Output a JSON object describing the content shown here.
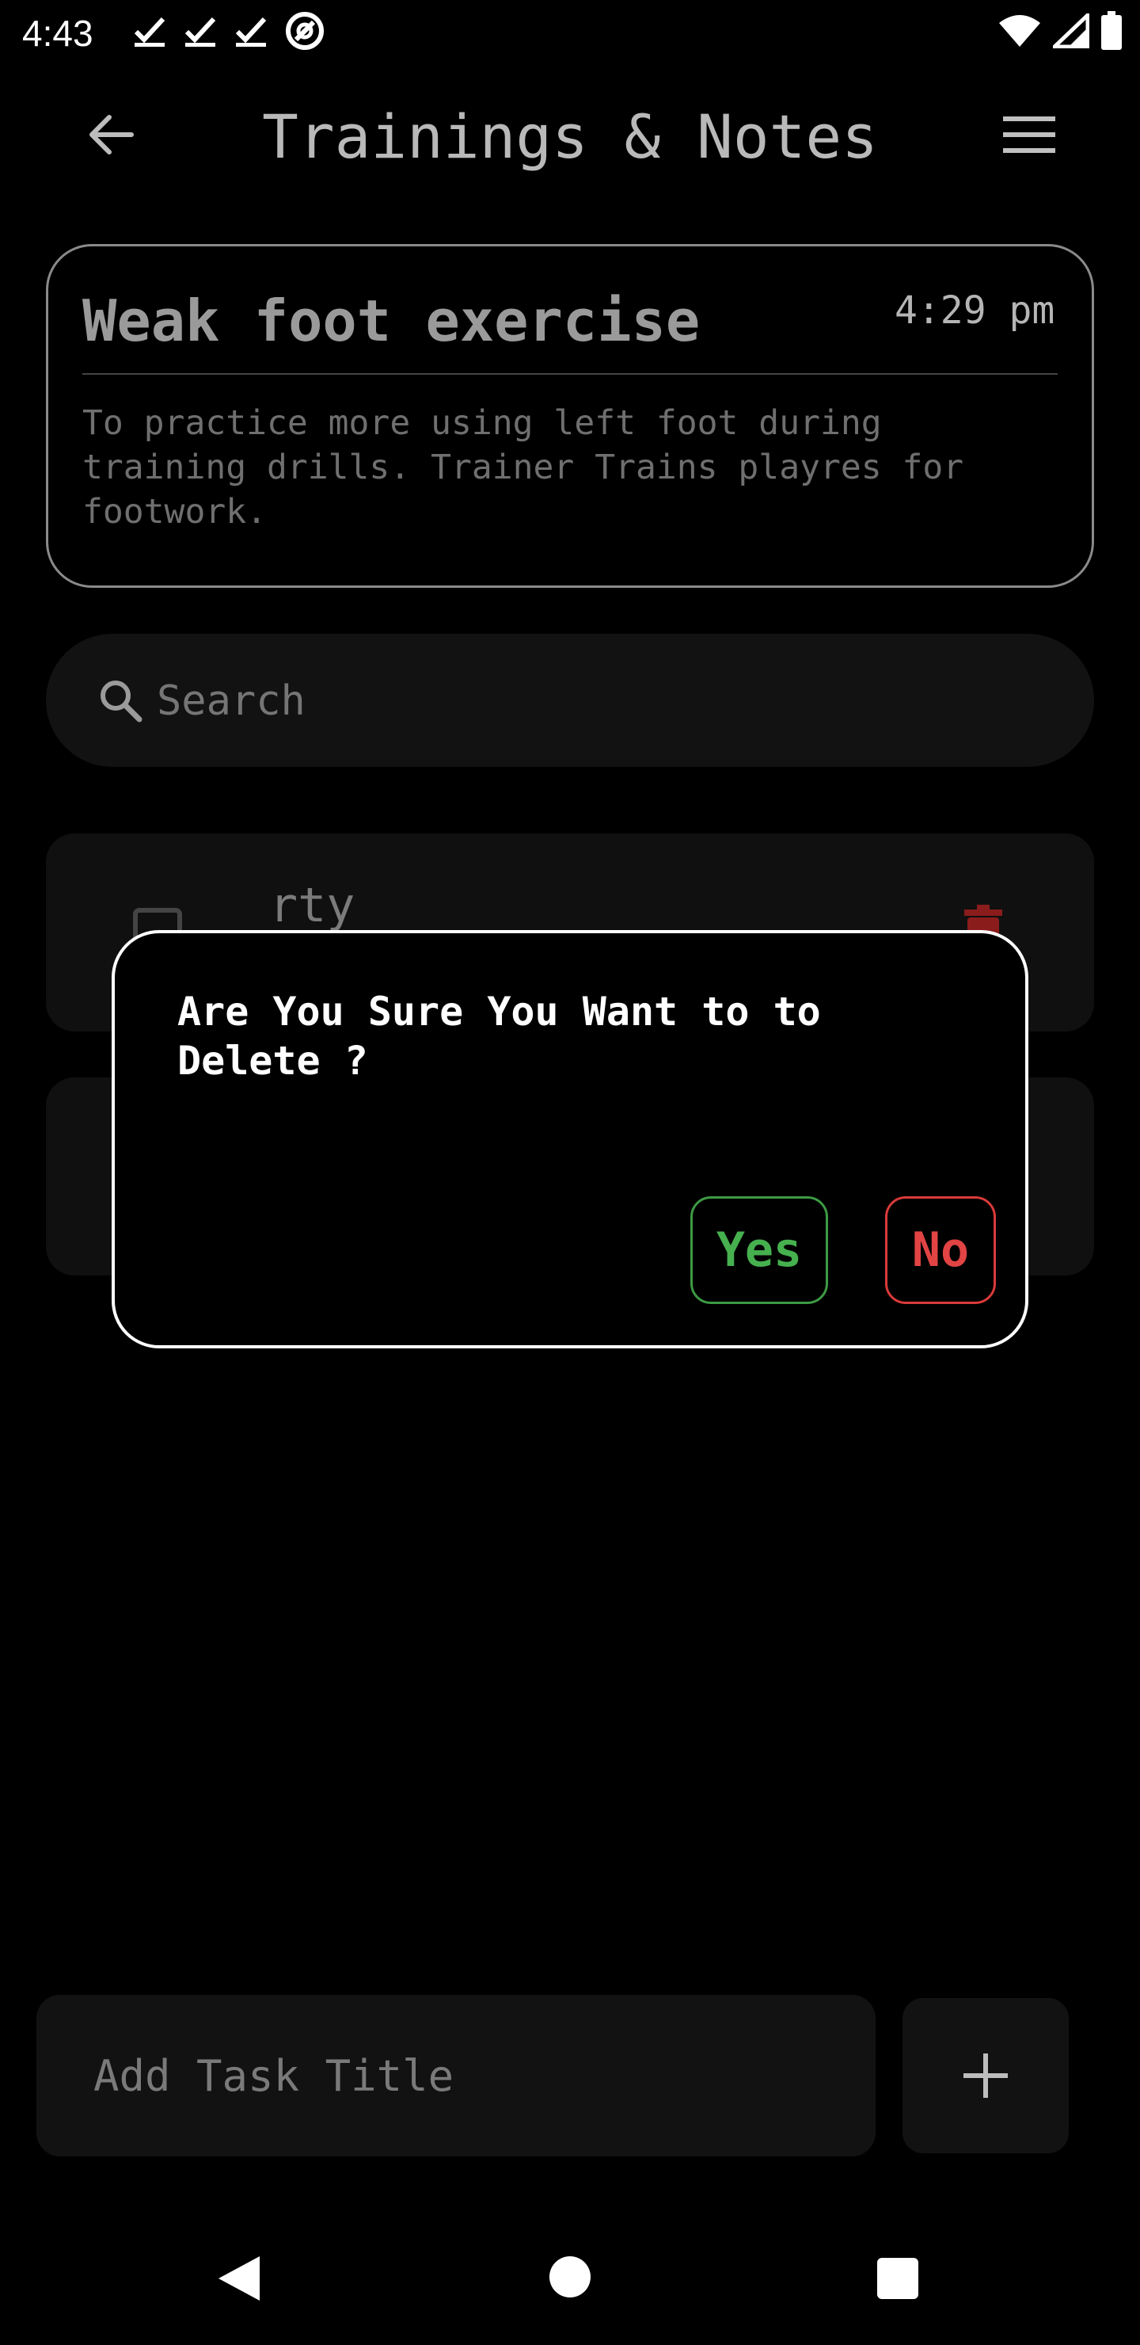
{
  "status_bar": {
    "time": "4:43",
    "left_icons": [
      "check-icon",
      "check-icon",
      "check-icon",
      "at-sign-icon"
    ],
    "right_icons": [
      "wifi-icon",
      "signal-icon",
      "battery-icon"
    ]
  },
  "header": {
    "title": "Trainings & Notes",
    "back_icon": "arrow-left-icon",
    "menu_icon": "menu-icon"
  },
  "note": {
    "title": "Weak foot exercise",
    "time": "4:29 pm",
    "body": "To practice more using left foot during training drills. Trainer Trains playres for footwork."
  },
  "search": {
    "placeholder": "Search"
  },
  "tasks": [
    {
      "title": "rty"
    },
    {
      "title": ""
    }
  ],
  "dialog": {
    "message": "Are You Sure You Want to to Delete ?",
    "yes_label": "Yes",
    "no_label": "No",
    "colors": {
      "yes": "#46b04f",
      "no": "#e24444"
    }
  },
  "add_task": {
    "placeholder": "Add Task Title",
    "add_icon": "plus-icon"
  },
  "nav_bar": {
    "icons": [
      "nav-back-icon",
      "nav-home-icon",
      "nav-recents-icon"
    ]
  }
}
